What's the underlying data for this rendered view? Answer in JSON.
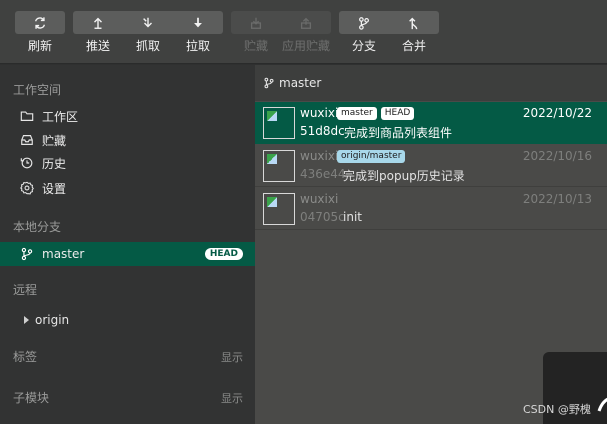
{
  "toolbar": {
    "buttons": [
      {
        "label": "刷新",
        "icon": "refresh-icon",
        "disabled": false
      },
      {
        "label": "推送",
        "icon": "push-icon",
        "disabled": false
      },
      {
        "label": "抓取",
        "icon": "fetch-icon",
        "disabled": false
      },
      {
        "label": "拉取",
        "icon": "pull-icon",
        "disabled": false
      },
      {
        "label": "贮藏",
        "icon": "stash-icon",
        "disabled": true
      },
      {
        "label": "应用贮藏",
        "icon": "apply-stash-icon",
        "disabled": true
      },
      {
        "label": "分支",
        "icon": "branch-icon",
        "disabled": false
      },
      {
        "label": "合并",
        "icon": "merge-icon",
        "disabled": false
      }
    ]
  },
  "sidebar": {
    "workspace_title": "工作空间",
    "workspace_items": [
      {
        "label": "工作区",
        "icon": "folder-icon"
      },
      {
        "label": "贮藏",
        "icon": "inbox-icon"
      },
      {
        "label": "历史",
        "icon": "history-icon"
      },
      {
        "label": "设置",
        "icon": "gear-icon"
      }
    ],
    "local_title": "本地分支",
    "local_branches": [
      {
        "label": "master",
        "badge": "HEAD"
      }
    ],
    "remote_title": "远程",
    "remotes": [
      {
        "label": "origin"
      }
    ],
    "tags_title": "标签",
    "tags_action": "显示",
    "submodules_title": "子模块",
    "submodules_action": "显示"
  },
  "main": {
    "branch_name": "master",
    "commits": [
      {
        "author": "wuxixi",
        "tags": [
          "master",
          "HEAD"
        ],
        "date": "2022/10/22",
        "hash": "51d8dc",
        "message": "完成到商品列表组件",
        "active": true
      },
      {
        "author": "wuxixi",
        "tags": [
          "origin/master"
        ],
        "date": "2022/10/16",
        "hash": "436e44",
        "message": "完成到popup历史记录",
        "active": false
      },
      {
        "author": "wuxixi",
        "tags": [],
        "date": "2022/10/13",
        "hash": "04705c",
        "message": "init",
        "active": false
      }
    ]
  },
  "watermark": "CSDN @野槐",
  "colors": {
    "accent": "#045a45",
    "toolbar_bg": "#404140",
    "sidebar_bg": "#323333",
    "main_bg": "#4a4a48",
    "remote_tag": "#a8d8ea"
  }
}
